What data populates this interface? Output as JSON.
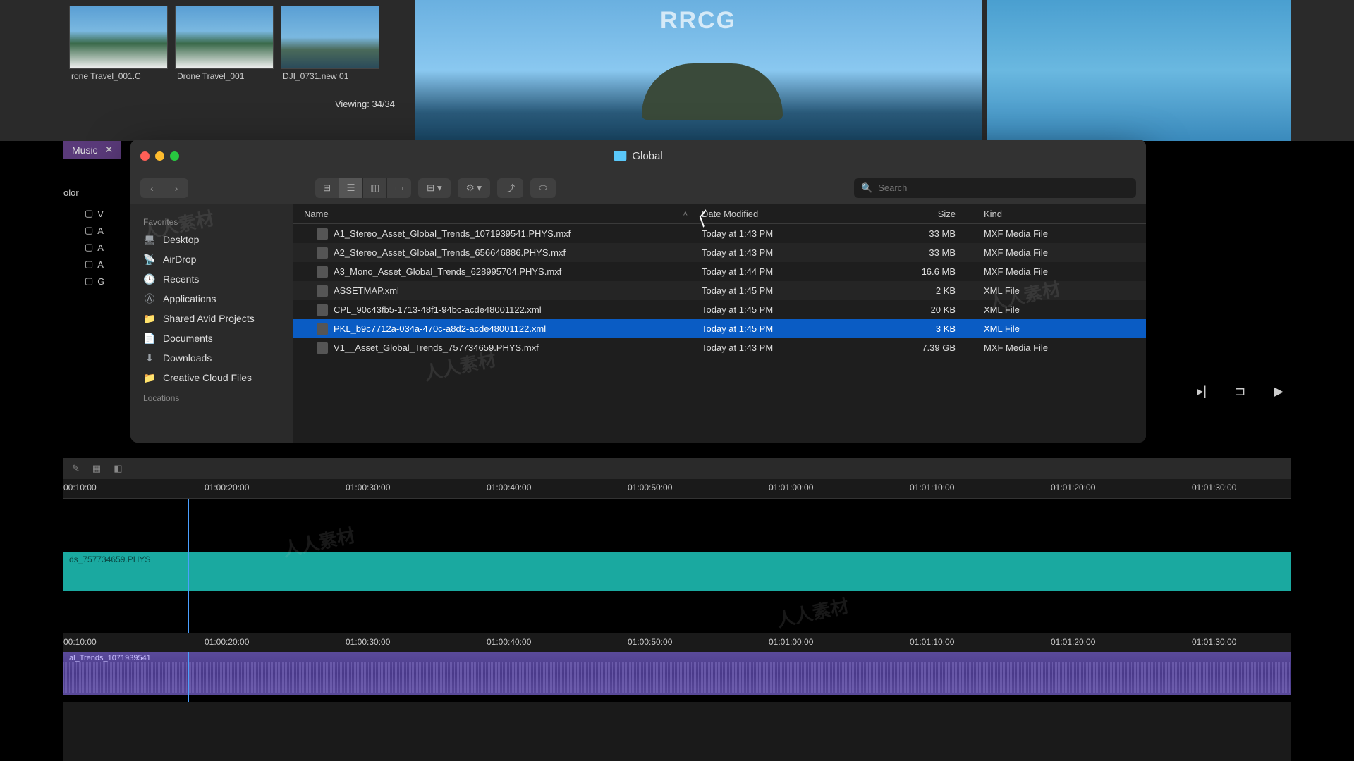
{
  "bin": {
    "thumb1_label": "rone Travel_001.C",
    "thumb2_label": "Drone Travel_001",
    "thumb3_label": "DJI_0731.new 01",
    "viewing": "Viewing: 34/34"
  },
  "viewer_watermark": "RRCG",
  "music_tab": {
    "label": "Music",
    "close": "✕"
  },
  "color_label": "olor",
  "tracks": {
    "v": "V",
    "a1": "A",
    "a2": "A",
    "a3": "A",
    "g": "G"
  },
  "finder": {
    "title": "Global",
    "search_placeholder": "Search",
    "sidebar": {
      "favorites_header": "Favorites",
      "items": [
        {
          "icon": "🖥",
          "label": "Desktop"
        },
        {
          "icon": "📡",
          "label": "AirDrop"
        },
        {
          "icon": "🕓",
          "label": "Recents"
        },
        {
          "icon": "Ⓐ",
          "label": "Applications"
        },
        {
          "icon": "📁",
          "label": "Shared Avid Projects"
        },
        {
          "icon": "📄",
          "label": "Documents"
        },
        {
          "icon": "⬇",
          "label": "Downloads"
        },
        {
          "icon": "📁",
          "label": "Creative Cloud Files"
        }
      ],
      "locations_header": "Locations"
    },
    "columns": {
      "name": "Name",
      "date": "Date Modified",
      "size": "Size",
      "kind": "Kind"
    },
    "files": [
      {
        "name": "A1_Stereo_Asset_Global_Trends_1071939541.PHYS.mxf",
        "date": "Today at 1:43 PM",
        "size": "33 MB",
        "kind": "MXF Media File",
        "selected": false
      },
      {
        "name": "A2_Stereo_Asset_Global_Trends_656646886.PHYS.mxf",
        "date": "Today at 1:43 PM",
        "size": "33 MB",
        "kind": "MXF Media File",
        "selected": false
      },
      {
        "name": "A3_Mono_Asset_Global_Trends_628995704.PHYS.mxf",
        "date": "Today at 1:44 PM",
        "size": "16.6 MB",
        "kind": "MXF Media File",
        "selected": false
      },
      {
        "name": "ASSETMAP.xml",
        "date": "Today at 1:45 PM",
        "size": "2 KB",
        "kind": "XML File",
        "selected": false
      },
      {
        "name": "CPL_90c43fb5-1713-48f1-94bc-acde48001122.xml",
        "date": "Today at 1:45 PM",
        "size": "20 KB",
        "kind": "XML File",
        "selected": false
      },
      {
        "name": "PKL_b9c7712a-034a-470c-a8d2-acde48001122.xml",
        "date": "Today at 1:45 PM",
        "size": "3 KB",
        "kind": "XML File",
        "selected": true
      },
      {
        "name": "V1__Asset_Global_Trends_757734659.PHYS.mxf",
        "date": "Today at 1:43 PM",
        "size": "7.39 GB",
        "kind": "MXF Media File",
        "selected": false
      }
    ]
  },
  "timeline": {
    "ticks": [
      "00:10:00",
      "01:00:20:00",
      "01:00:30:00",
      "01:00:40:00",
      "01:00:50:00",
      "01:01:00:00",
      "01:01:10:00",
      "01:01:20:00",
      "01:01:30:00"
    ],
    "video_clip": "ds_757734659.PHYS",
    "audio_clip": "al_Trends_1071939541"
  },
  "watermark_text": "人人素材"
}
